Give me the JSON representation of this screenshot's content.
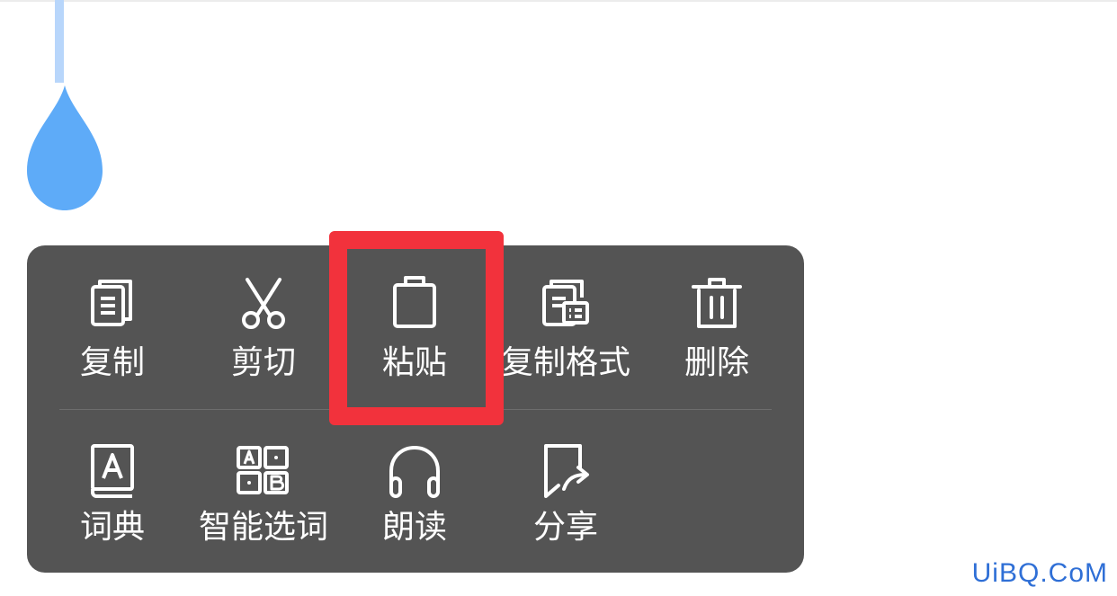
{
  "menu": {
    "row1": [
      {
        "label": "复制",
        "icon": "copy-icon"
      },
      {
        "label": "剪切",
        "icon": "scissors-icon"
      },
      {
        "label": "粘贴",
        "icon": "clipboard-icon"
      },
      {
        "label": "复制格式",
        "icon": "copy-format-icon"
      },
      {
        "label": "删除",
        "icon": "trash-icon"
      }
    ],
    "row2": [
      {
        "label": "词典",
        "icon": "dictionary-icon"
      },
      {
        "label": "智能选词",
        "icon": "smart-select-icon"
      },
      {
        "label": "朗读",
        "icon": "headphones-icon"
      },
      {
        "label": "分享",
        "icon": "share-icon"
      }
    ]
  },
  "watermark": "UiBQ.CoM",
  "colors": {
    "menu_bg": "#545454",
    "highlight": "#f2323c",
    "handle": "#5eabf8",
    "watermark": "#2f6fd6"
  }
}
